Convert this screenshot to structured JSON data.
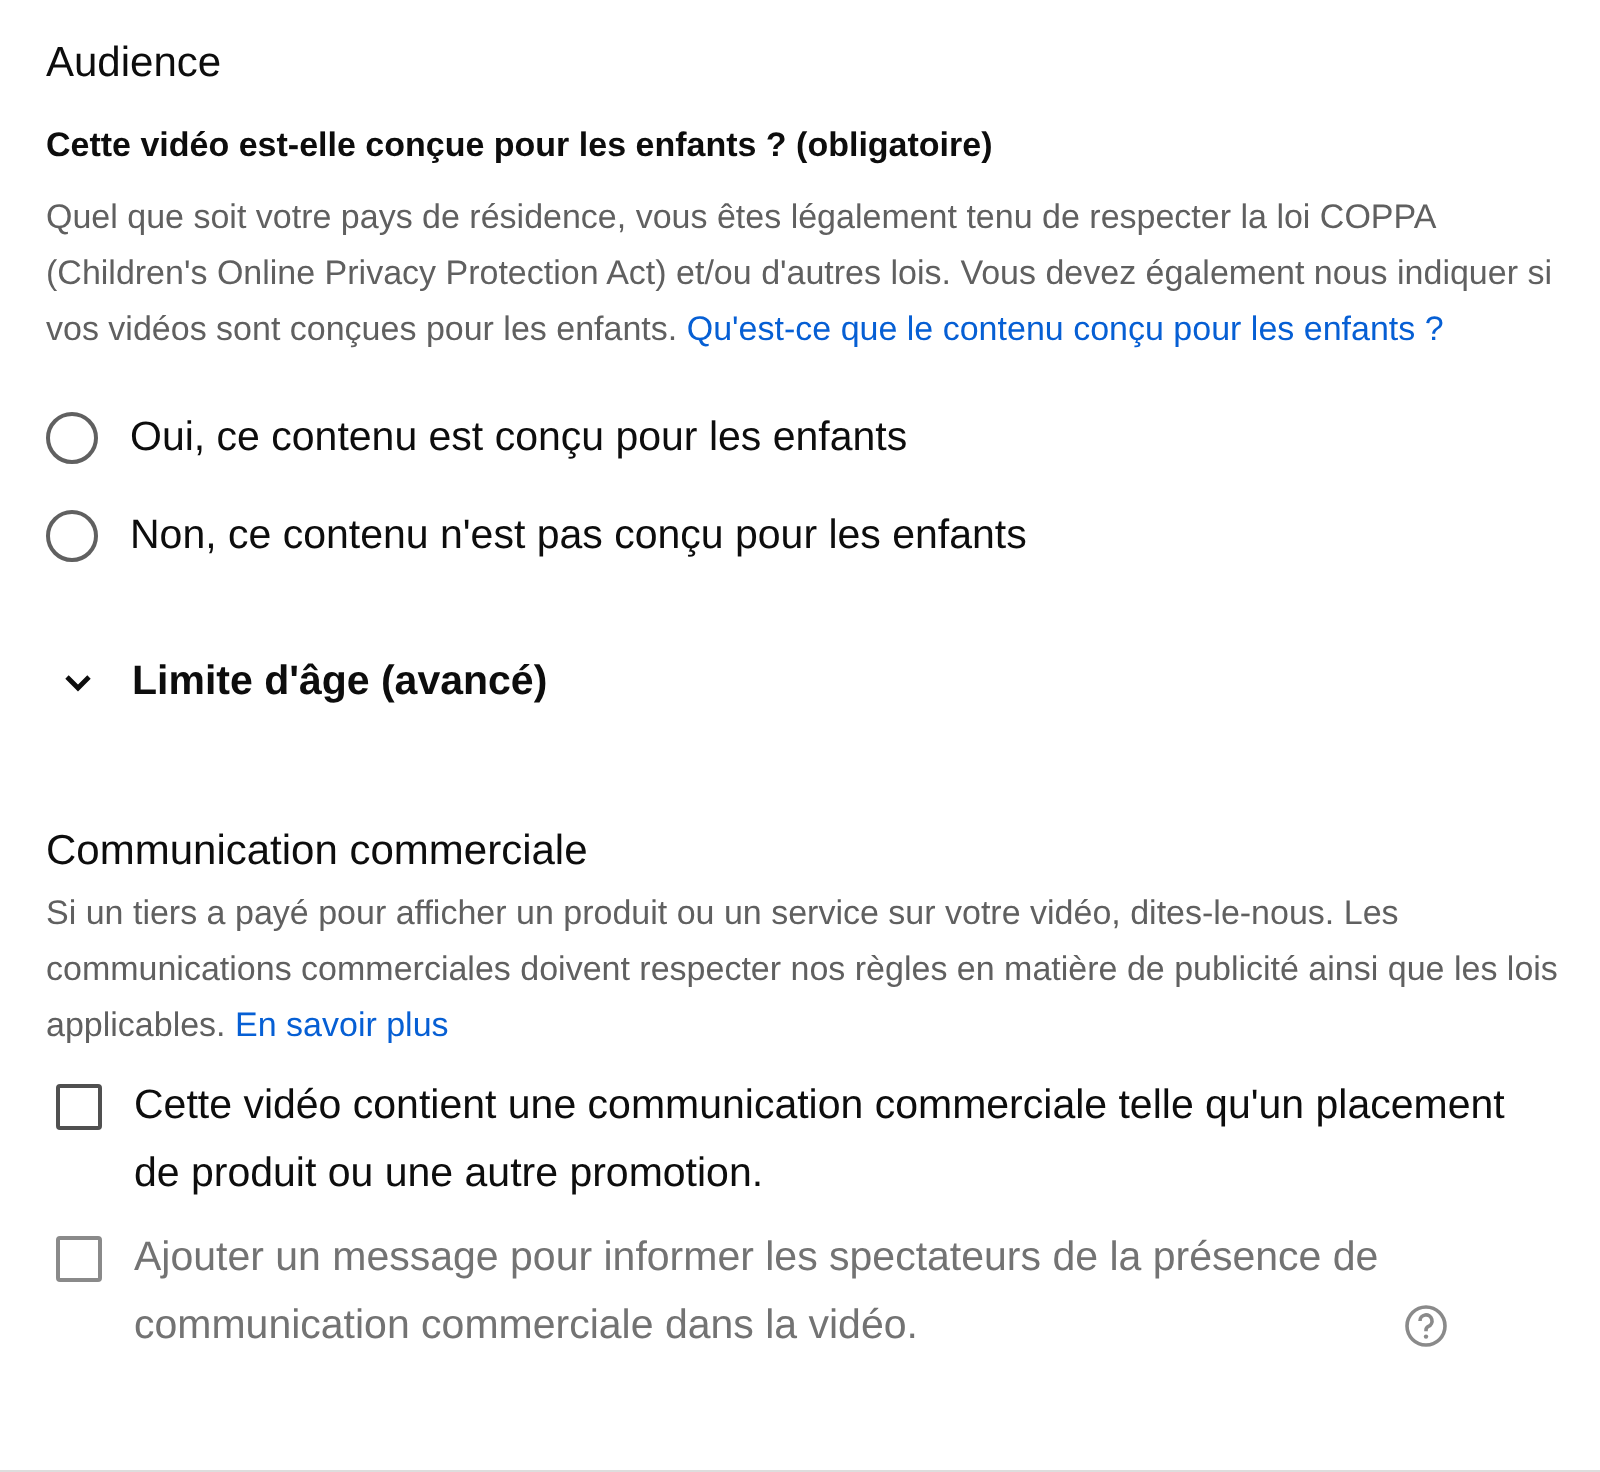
{
  "audience": {
    "title": "Audience",
    "question": "Cette vidéo est-elle conçue pour les enfants ? (obligatoire)",
    "description": {
      "text": "Quel que soit votre pays de résidence, vous êtes légalement tenu de respecter la loi COPPA (Children's Online Privacy Protection Act) et/ou d'autres lois. Vous devez également nous indiquer si vos vidéos sont conçues pour les enfants.",
      "link": "Qu'est-ce que le contenu conçu pour les enfants ?"
    },
    "options": [
      {
        "label": "Oui, ce contenu est conçu pour les enfants",
        "selected": false
      },
      {
        "label": "Non, ce contenu n'est pas conçu pour les enfants",
        "selected": false
      }
    ]
  },
  "age_restriction": {
    "label": "Limite d'âge (avancé)",
    "expanded": false
  },
  "commercial": {
    "title": "Communication commerciale",
    "description": {
      "text": "Si un tiers a payé pour afficher un produit ou un service sur votre vidéo, dites-le-nous. Les communications commerciales doivent respecter nos règles en matière de publicité ainsi que les lois applicables.",
      "link": "En savoir plus"
    },
    "checkboxes": [
      {
        "label": "Cette vidéo contient une communication commerciale telle qu'un placement de produit ou une autre promotion.",
        "checked": false,
        "disabled": false,
        "help": false
      },
      {
        "label": "Ajouter un message pour informer les spectateurs de la présence de communication commerciale dans la vidéo.",
        "checked": false,
        "disabled": true,
        "help": true
      }
    ]
  }
}
